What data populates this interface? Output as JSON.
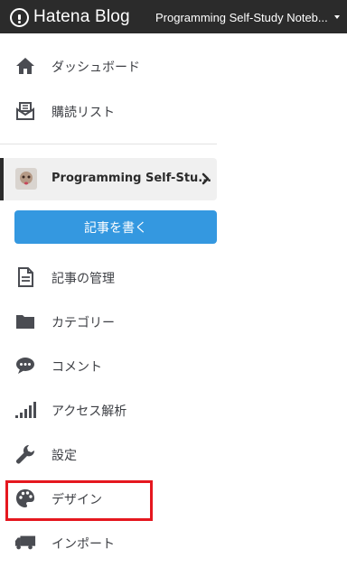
{
  "header": {
    "logo_text": "Hatena Blog",
    "blog_switcher_label": "Programming Self-Study Noteb..."
  },
  "nav_top": [
    {
      "label": "ダッシュボード",
      "icon": "home-icon"
    },
    {
      "label": "購読リスト",
      "icon": "subscription-icon"
    }
  ],
  "blog_card": {
    "title": "Programming Self-Stu...",
    "avatar": "blog-avatar-image"
  },
  "write_button_label": "記事を書く",
  "nav_blog": [
    {
      "label": "記事の管理",
      "icon": "document-icon"
    },
    {
      "label": "カテゴリー",
      "icon": "folder-icon"
    },
    {
      "label": "コメント",
      "icon": "comment-icon"
    },
    {
      "label": "アクセス解析",
      "icon": "analytics-bars-icon"
    },
    {
      "label": "設定",
      "icon": "wrench-icon"
    },
    {
      "label": "デザイン",
      "icon": "palette-icon"
    },
    {
      "label": "インポート",
      "icon": "truck-icon"
    }
  ],
  "colors": {
    "header_bg": "#2b2b2b",
    "accent_blue": "#3498e0",
    "highlight_red": "#e5171f",
    "icon_gray": "#4a4c52"
  }
}
